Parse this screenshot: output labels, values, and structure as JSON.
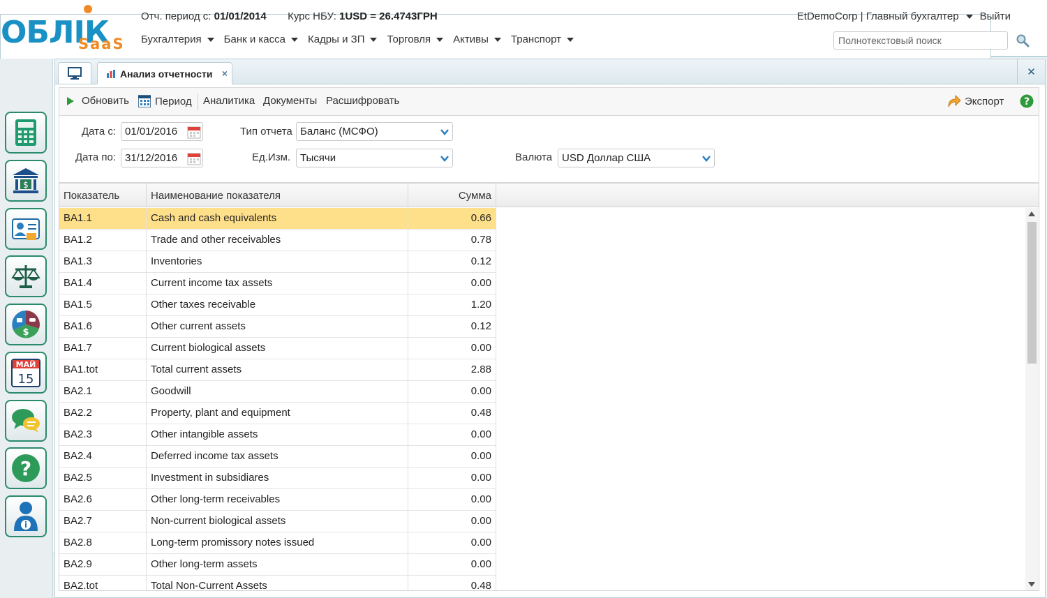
{
  "header": {
    "logo_main": "ОБЛІК",
    "logo_sub": "SaaS",
    "period_label": "Отч. период с:",
    "period_value": "01/01/2014",
    "rate_label": "Курс НБУ:",
    "rate_value": "1USD = 26.4743ГРН",
    "user": "EtDemoCorp | Главный бухгалтер",
    "logout": "Выйти",
    "search_placeholder": "Полнотекстовый поиск",
    "menu": [
      {
        "label": "Бухгалтерия"
      },
      {
        "label": "Банк и касса"
      },
      {
        "label": "Кадры и ЗП"
      },
      {
        "label": "Торговля"
      },
      {
        "label": "Активы"
      },
      {
        "label": "Транспорт"
      }
    ]
  },
  "sidebar": {
    "calendar_month": "МАЙ",
    "calendar_day": "15",
    "items": [
      {
        "icon": "calculator-icon"
      },
      {
        "icon": "bank-icon"
      },
      {
        "icon": "employee-card-icon"
      },
      {
        "icon": "scales-icon"
      },
      {
        "icon": "assets-icon"
      },
      {
        "icon": "calendar-icon"
      },
      {
        "icon": "chat-icon"
      },
      {
        "icon": "help-icon"
      },
      {
        "icon": "user-info-icon"
      }
    ]
  },
  "tabs": {
    "active_label": "Анализ отчетности",
    "close_symbol": "×"
  },
  "toolbar": {
    "refresh": "Обновить",
    "period": "Период",
    "analytics": "Аналитика",
    "documents": "Документы",
    "decode": "Расшифровать",
    "export": "Экспорт"
  },
  "filters": {
    "date_from_label": "Дата с:",
    "date_from": "01/01/2016",
    "date_to_label": "Дата по:",
    "date_to": "31/12/2016",
    "report_type_label": "Тип отчета",
    "report_type": "Баланс (МСФО)",
    "unit_label": "Ед.Изм.",
    "unit": "Тысячи",
    "currency_label": "Валюта",
    "currency": "USD Доллар США"
  },
  "grid": {
    "columns": [
      "Показатель",
      "Наименование показателя",
      "Сумма"
    ],
    "rows": [
      {
        "code": "BA1.1",
        "name": "Cash and cash equivalents",
        "sum": "0.66"
      },
      {
        "code": "BA1.2",
        "name": "Trade and other receivables",
        "sum": "0.78"
      },
      {
        "code": "BA1.3",
        "name": "Inventories",
        "sum": "0.12"
      },
      {
        "code": "BA1.4",
        "name": "Current income tax assets",
        "sum": "0.00"
      },
      {
        "code": "BA1.5",
        "name": "Other taxes receivable",
        "sum": "1.20"
      },
      {
        "code": "BA1.6",
        "name": "Other current assets",
        "sum": "0.12"
      },
      {
        "code": "BA1.7",
        "name": "Current biological assets",
        "sum": "0.00"
      },
      {
        "code": "BA1.tot",
        "name": "Total current assets",
        "sum": "2.88"
      },
      {
        "code": "BA2.1",
        "name": "Goodwill",
        "sum": "0.00"
      },
      {
        "code": "BA2.2",
        "name": "Property, plant and equipment",
        "sum": "0.48"
      },
      {
        "code": "BA2.3",
        "name": "Other intangible assets",
        "sum": "0.00"
      },
      {
        "code": "BA2.4",
        "name": "Deferred income tax assets",
        "sum": "0.00"
      },
      {
        "code": "BA2.5",
        "name": "Investment in subsidiares",
        "sum": "0.00"
      },
      {
        "code": "BA2.6",
        "name": "Other long-term receivables",
        "sum": "0.00"
      },
      {
        "code": "BA2.7",
        "name": "Non-current biological assets",
        "sum": "0.00"
      },
      {
        "code": "BA2.8",
        "name": "Long-term promissory notes issued",
        "sum": "0.00"
      },
      {
        "code": "BA2.9",
        "name": "Other long-term assets",
        "sum": "0.00"
      },
      {
        "code": "BA2.tot",
        "name": "Total Non-Current Assets",
        "sum": "0.48"
      }
    ],
    "selected_row": 0
  },
  "colors": {
    "brand_blue": "#1a91c4",
    "brand_orange": "#f08a24",
    "selected_row": "#ffe08a",
    "sidebar_border": "#2a8a6a"
  }
}
